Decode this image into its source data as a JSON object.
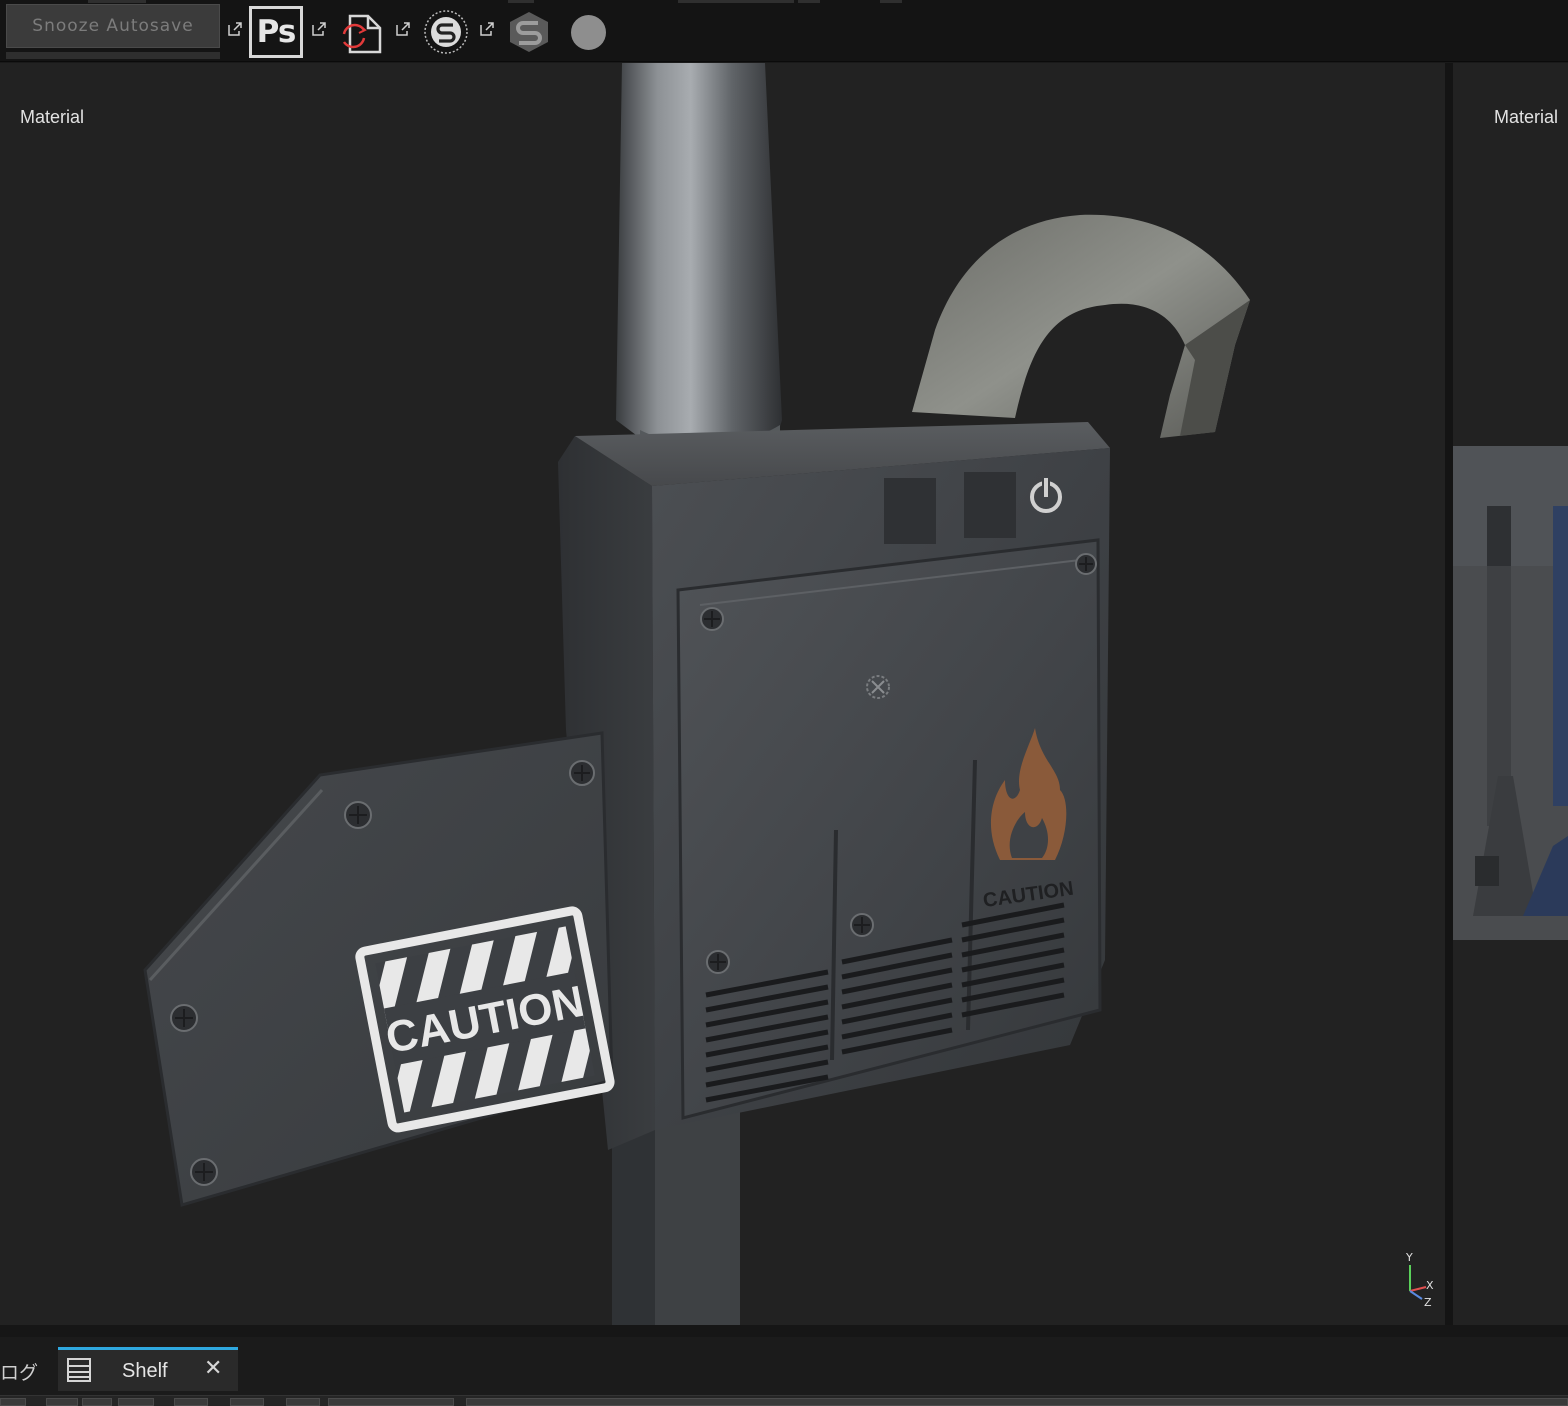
{
  "toolbar": {
    "snooze_label": "Snooze Autosave",
    "photoshop_label": "Ps",
    "icons": [
      "external-link-icon",
      "photoshop-icon",
      "export-refresh-icon",
      "substance-launcher-icon",
      "substance-logo-icon",
      "record-circle-icon"
    ]
  },
  "viewport": {
    "label": "Material",
    "overlay_text": {
      "caution_sign": "CAUTION",
      "caution_small": "CAUTION"
    },
    "axis": {
      "y": "Y",
      "x": "X",
      "z": "Z"
    }
  },
  "viewport2": {
    "label": "Material"
  },
  "bottom": {
    "tab_log": "ログ",
    "tab_shelf": "Shelf",
    "close_glyph": "✕"
  },
  "colors": {
    "toolbar_bg": "#141414",
    "viewport_bg": "#222222",
    "accent_tab": "#2fa8e0",
    "metal_dark": "#3c3f43",
    "metal_light": "#8a8d90",
    "rust": "#8a5a3a"
  }
}
